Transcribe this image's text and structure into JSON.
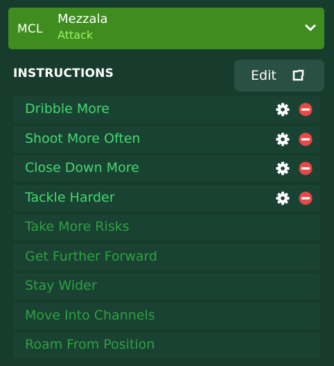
{
  "role": {
    "position": "MCL",
    "name": "Mezzala",
    "duty": "Attack",
    "dropdown_icon": "chevron-down-icon"
  },
  "instructions": {
    "title": "INSTRUCTIONS",
    "edit_label": "Edit",
    "edit_icon": "expand-icon",
    "items": [
      {
        "label": "Dribble More",
        "active": true
      },
      {
        "label": "Shoot More Often",
        "active": true
      },
      {
        "label": "Close Down More",
        "active": true
      },
      {
        "label": "Tackle Harder",
        "active": true
      },
      {
        "label": "Take More Risks",
        "active": false
      },
      {
        "label": "Get Further Forward",
        "active": false
      },
      {
        "label": "Stay Wider",
        "active": false
      },
      {
        "label": "Move Into Channels",
        "active": false
      },
      {
        "label": "Roam From Position",
        "active": false
      }
    ]
  },
  "colors": {
    "background": "#173c2d",
    "role_bar": "#3f8d1f",
    "duty_text": "#9ef264",
    "active_instruction": "#44d870",
    "inactive_instruction": "#2da141",
    "remove_icon": "#e84848"
  }
}
